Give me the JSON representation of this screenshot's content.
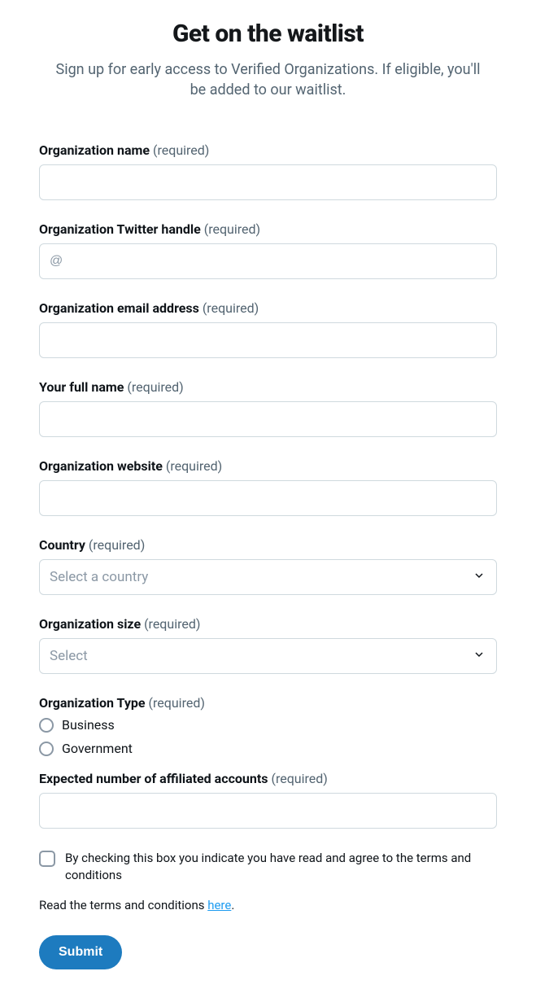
{
  "header": {
    "title": "Get on the waitlist",
    "subtitle": "Sign up for early access to Verified Organizations. If eligible, you'll be added to our waitlist."
  },
  "fields": {
    "required_suffix": "(required)",
    "org_name": {
      "label": "Organization name",
      "value": ""
    },
    "org_handle": {
      "label": "Organization Twitter handle",
      "placeholder": "@",
      "value": ""
    },
    "org_email": {
      "label": "Organization email address",
      "value": ""
    },
    "full_name": {
      "label": "Your full name",
      "value": ""
    },
    "org_website": {
      "label": "Organization website",
      "value": ""
    },
    "country": {
      "label": "Country",
      "placeholder": "Select a country"
    },
    "org_size": {
      "label": "Organization size",
      "placeholder": "Select"
    },
    "org_type": {
      "label": "Organization Type",
      "options": [
        "Business",
        "Government"
      ]
    },
    "affiliated": {
      "label": "Expected number of affiliated accounts",
      "value": ""
    }
  },
  "consent": {
    "checkbox_label": "By checking this box you indicate you have read and agree to the terms and conditions",
    "terms_prefix": "Read the terms and conditions ",
    "terms_link": "here",
    "terms_suffix": "."
  },
  "submit_label": "Submit"
}
